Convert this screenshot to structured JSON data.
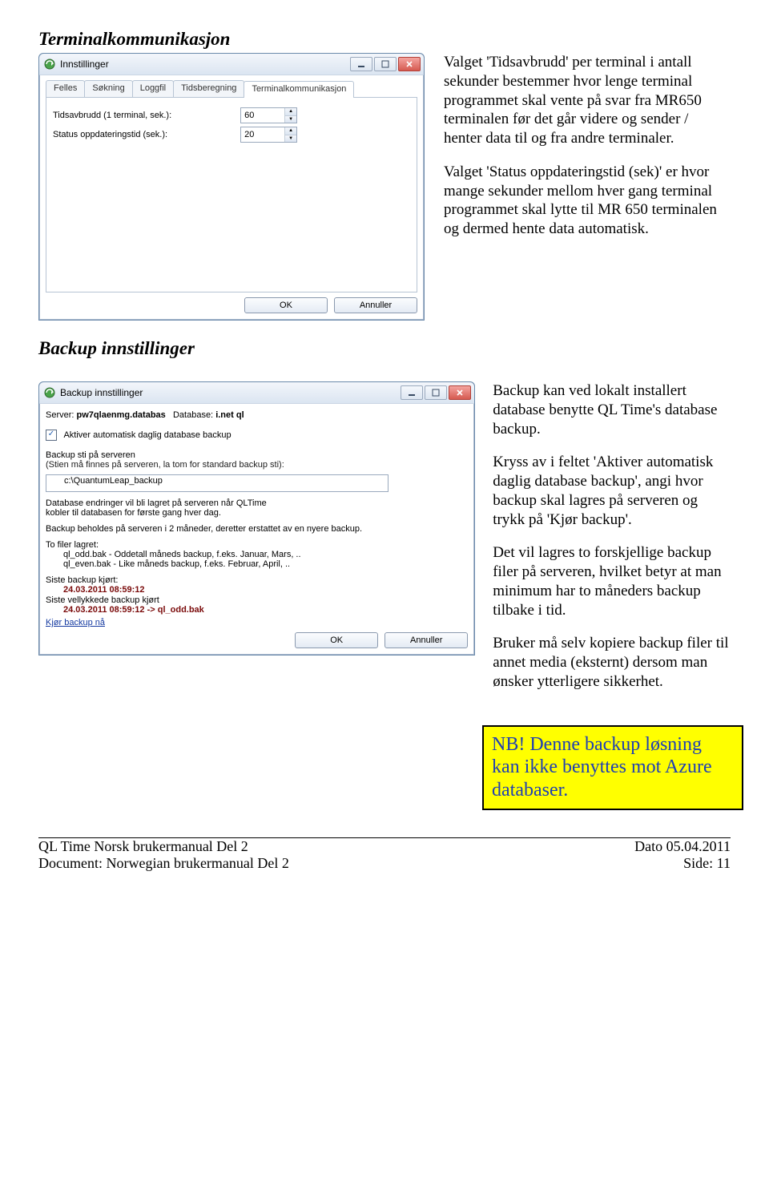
{
  "section1": {
    "title": "Terminalkommunikasjon",
    "p1": "Valget 'Tidsavbrudd' per terminal i antall sekunder bestemmer hvor lenge terminal programmet skal vente på svar fra MR650 terminalen før det går videre og sender / henter data til og fra andre terminaler.",
    "p2": "Valget 'Status oppdateringstid (sek)' er hvor mange sekunder mellom hver gang terminal programmet skal lytte til MR 650 terminalen og dermed hente data automatisk."
  },
  "settings_window": {
    "title": "Innstillinger",
    "tabs": [
      "Felles",
      "Søkning",
      "Loggfil",
      "Tidsberegning",
      "Terminalkommunikasjon"
    ],
    "row1_label": "Tidsavbrudd  (1 terminal, sek.):",
    "row1_value": "60",
    "row2_label": "Status oppdateringstid (sek.):",
    "row2_value": "20",
    "ok": "OK",
    "cancel": "Annuller"
  },
  "section2": {
    "title": "Backup innstillinger",
    "p1": "Backup kan ved lokalt installert database benytte QL Time's database backup.",
    "p2": "Kryss av i feltet 'Aktiver automatisk daglig database backup', angi hvor backup skal lagres på serveren og trykk på 'Kjør backup'.",
    "p3": "Det vil lagres to forskjellige backup filer på serveren, hvilket betyr at man minimum har to måneders backup tilbake i tid.",
    "p4": "Bruker må selv kopiere backup filer til annet media (eksternt) dersom man ønsker ytterligere sikkerhet."
  },
  "backup_window": {
    "title": "Backup innstillinger",
    "server_label": "Server:",
    "server_value": "pw7qlaenmg.databas",
    "database_label": "Database:",
    "database_value": "i.net ql",
    "activate": "Aktiver automatisk daglig database backup",
    "path_label": "Backup sti på serveren",
    "path_hint": "(Stien må finnes på serveren, la tom for standard backup sti):",
    "path_value": "c:\\QuantumLeap_backup",
    "changes_note1": "Database endringer vil bli lagret på serveren når QLTime",
    "changes_note2": "kobler til databasen for første gang hver dag.",
    "retention": "Backup beholdes på serveren i 2 måneder, deretter erstattet av en nyere backup.",
    "two_files": "To filer lagret:",
    "file_odd": "ql_odd.bak - Oddetall måneds backup, f.eks. Januar, Mars, ..",
    "file_even": "ql_even.bak - Like måneds backup, f.eks. Februar, April, ..",
    "last_label": "Siste backup kjørt:",
    "last_value": "24.03.2011 08:59:12",
    "last_ok_label": "Siste vellykkede backup kjørt",
    "last_ok_value": "24.03.2011 08:59:12 -> ql_odd.bak",
    "run_now": "Kjør backup nå",
    "ok": "OK",
    "cancel": "Annuller"
  },
  "note": "NB! Denne backup løsning kan ikke benyttes mot Azure databaser.",
  "footer": {
    "l1": "QL Time Norsk brukermanual Del 2",
    "l2": "Document: Norwegian brukermanual Del 2",
    "r1": "Dato 05.04.2011",
    "r2": "Side: 11"
  }
}
